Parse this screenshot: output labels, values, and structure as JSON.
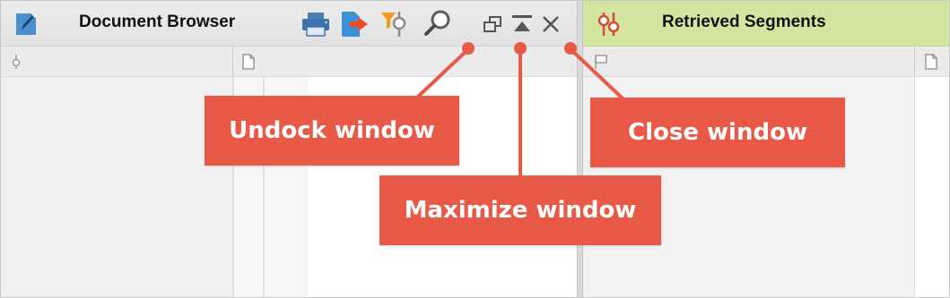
{
  "document_browser": {
    "title": "Document Browser",
    "toolbar_icons": [
      "edit-icon",
      "print-icon",
      "export-icon",
      "filter-icon",
      "search-icon"
    ],
    "window_controls": [
      "undock-icon",
      "maximize-icon",
      "close-icon"
    ]
  },
  "retrieved_segments": {
    "title": "Retrieved Segments",
    "header_color": "#d3e6a0"
  },
  "callouts": {
    "undock": "Undock window",
    "maximize": "Maximize window",
    "close": "Close window"
  },
  "colors": {
    "callout": "#e85a47",
    "accent_blue": "#3d8fd6"
  }
}
